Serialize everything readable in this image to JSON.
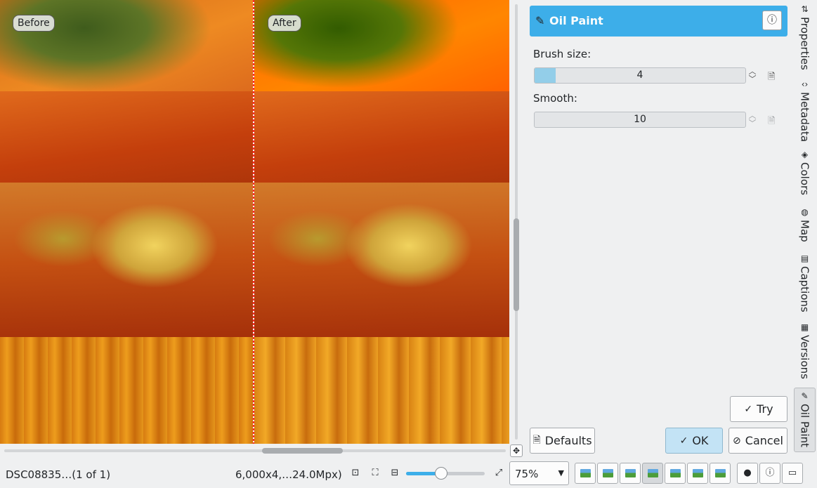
{
  "preview": {
    "before_label": "Before",
    "after_label": "After"
  },
  "tool": {
    "title": "Oil Paint",
    "brush_size": {
      "label": "Brush size:",
      "value": "4",
      "fill_fraction": 0.1
    },
    "smooth": {
      "label": "Smooth:",
      "value": "10",
      "fill_fraction": 0.0
    }
  },
  "buttons": {
    "try": "Try",
    "defaults": "Defaults",
    "ok": "OK",
    "cancel": "Cancel"
  },
  "side_tabs": [
    {
      "label": "Properties",
      "icon": "sliders-icon"
    },
    {
      "label": "Metadata",
      "icon": "code-icon"
    },
    {
      "label": "Colors",
      "icon": "paint-bucket-icon"
    },
    {
      "label": "Map",
      "icon": "globe-icon"
    },
    {
      "label": "Captions",
      "icon": "document-icon"
    },
    {
      "label": "Versions",
      "icon": "versions-icon"
    },
    {
      "label": "Oil Paint",
      "icon": "brush-icon"
    }
  ],
  "status": {
    "file": "DSC08835…(1 of 1)",
    "dimensions": "6,000x4,…24.0Mpx)",
    "zoom_value": "75%",
    "zoom_slider_fraction": 0.45
  }
}
